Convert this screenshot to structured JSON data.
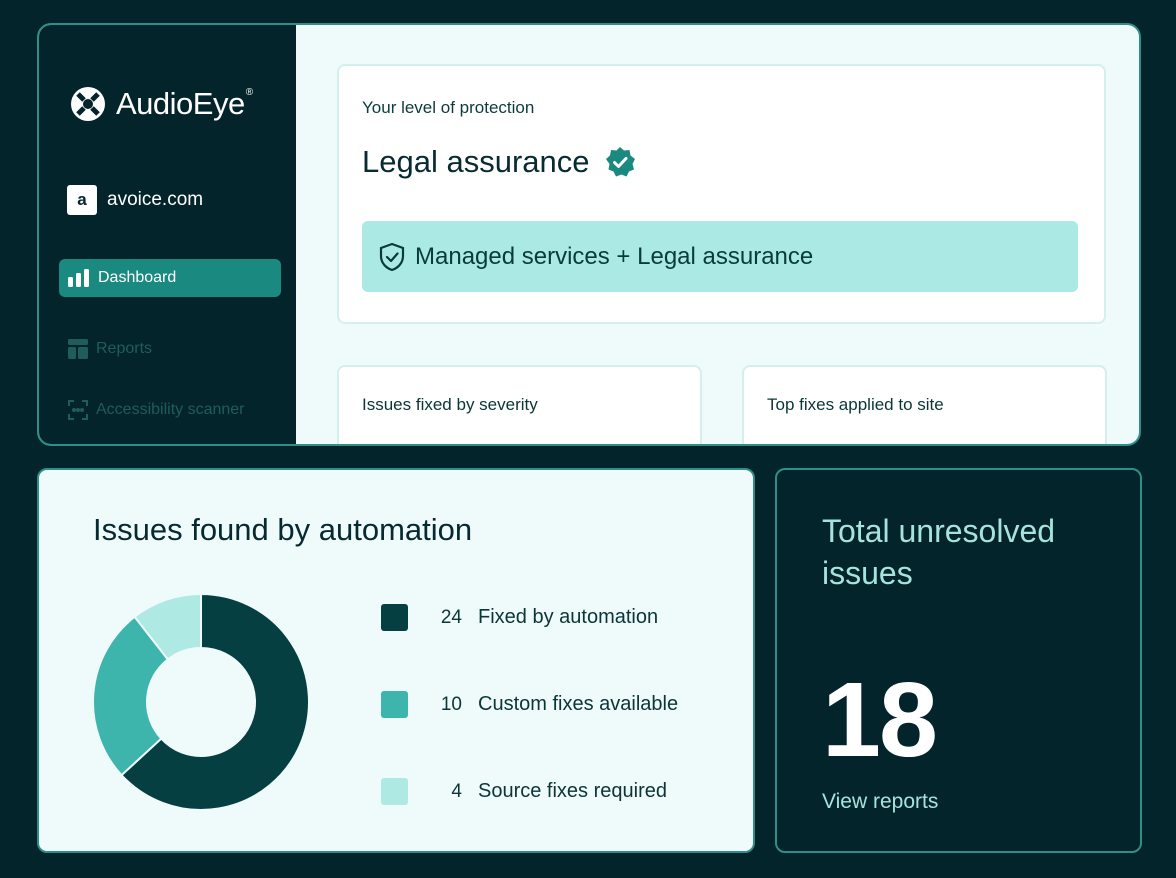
{
  "sidebar": {
    "logo_text": "AudioEye",
    "logo_mark": "®",
    "site_initial": "a",
    "site_name": "avoice.com",
    "items": [
      {
        "label": "Dashboard",
        "icon": "bar-chart-icon",
        "active": true
      },
      {
        "label": "Reports",
        "icon": "grid-icon",
        "active": false
      },
      {
        "label": "Accessibility scanner",
        "icon": "scanner-icon",
        "active": false
      }
    ]
  },
  "protection": {
    "label": "Your level of protection",
    "title": "Legal assurance",
    "plan": "Managed services + Legal assurance"
  },
  "mini_cards": {
    "severity_title": "Issues fixed by severity",
    "top_fixes_title": "Top fixes applied to site"
  },
  "issues": {
    "title": "Issues found by automation",
    "legend": [
      {
        "value": "24",
        "label": "Fixed by automation",
        "color": "#063f42"
      },
      {
        "value": "10",
        "label": "Custom fixes available",
        "color": "#3db5ad"
      },
      {
        "value": "4",
        "label": "Source fixes required",
        "color": "#aee9e3"
      }
    ]
  },
  "chart_data": {
    "type": "pie",
    "categories": [
      "Fixed by automation",
      "Custom fixes available",
      "Source fixes required"
    ],
    "values": [
      24,
      10,
      4
    ],
    "colors": [
      "#063f42",
      "#3db5ad",
      "#aee9e3"
    ],
    "title": "Issues found by automation"
  },
  "total": {
    "title": "Total unresolved issues",
    "value": "18",
    "link": "View reports"
  }
}
